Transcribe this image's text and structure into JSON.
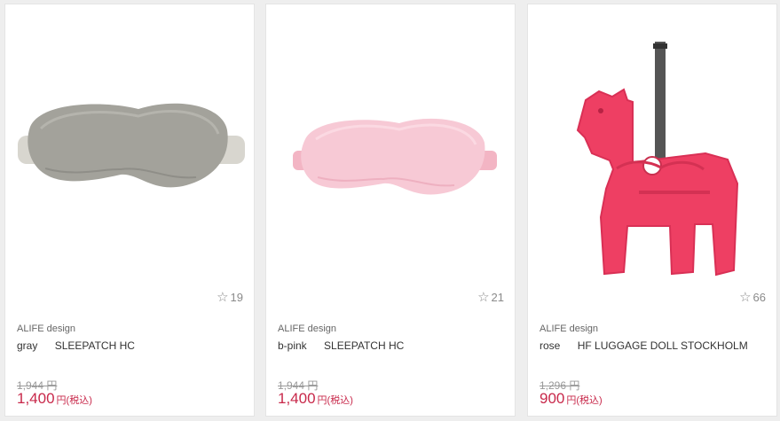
{
  "products": [
    {
      "brand": "ALIFE design",
      "color": "gray",
      "name": "SLEEPATCH HC",
      "old_price": "1,944 円",
      "price": "1,400",
      "price_unit": "円(税込)",
      "favorites": "19",
      "image_icon": "gray-sleep-mask-image"
    },
    {
      "brand": "ALIFE design",
      "color": "b-pink",
      "name": "SLEEPATCH HC",
      "old_price": "1,944 円",
      "price": "1,400",
      "price_unit": "円(税込)",
      "favorites": "21",
      "image_icon": "pink-sleep-mask-image"
    },
    {
      "brand": "ALIFE design",
      "color": "rose",
      "name": "HF LUGGAGE DOLL STOCKHOLM",
      "old_price": "1,296 円",
      "price": "900",
      "price_unit": "円(税込)",
      "favorites": "66",
      "image_icon": "horse-luggage-tag-image"
    }
  ],
  "icons": {
    "favorite": "star-outline-icon"
  },
  "colors": {
    "sale_price": "#c8284a",
    "old_price": "#999999",
    "mask_gray": "#a09f99",
    "mask_pink": "#f6c2cf",
    "tag_rose": "#ee3f63"
  }
}
